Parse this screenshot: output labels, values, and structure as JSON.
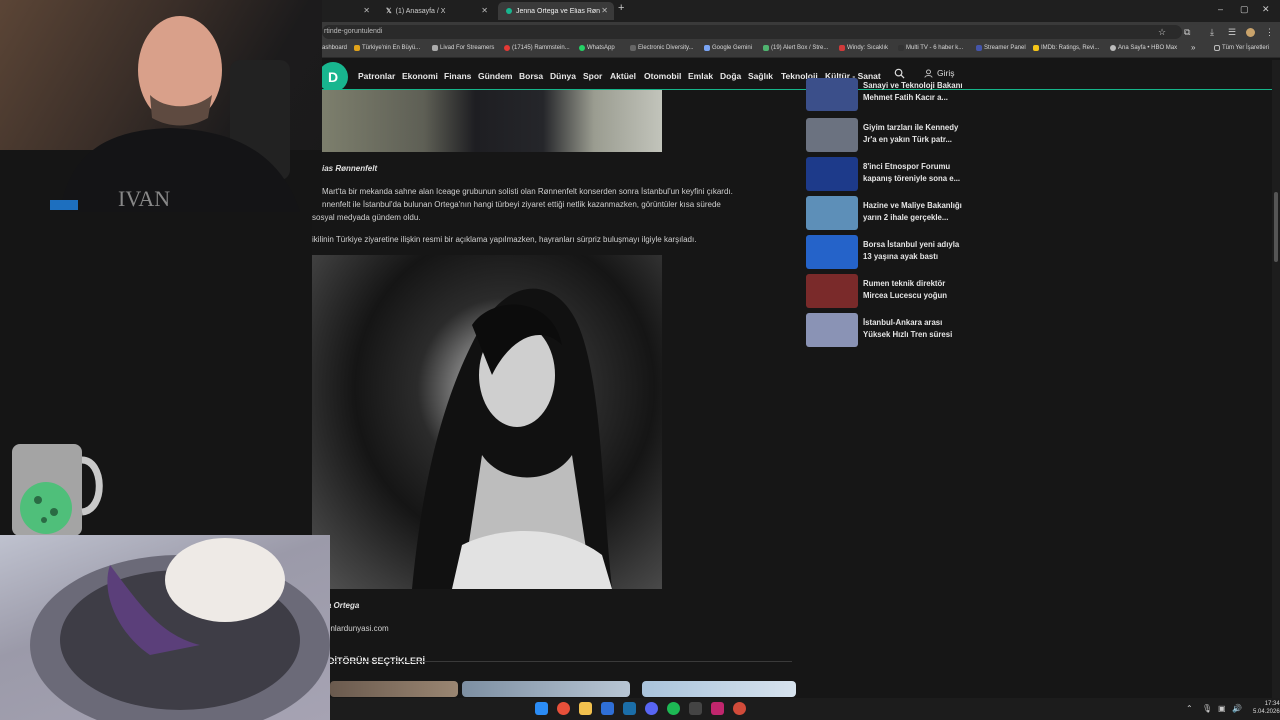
{
  "browser": {
    "tabs": [
      {
        "label": ""
      },
      {
        "label": "(1) Anasayfa / X"
      },
      {
        "label": "Jenna Ortega ve Elias Rønnenf..."
      }
    ],
    "url": "rtinde-goruntulendi",
    "bookmarks": [
      {
        "label": "ashboard"
      },
      {
        "label": "Türkiye'nin En Büyü..."
      },
      {
        "label": "Livad For Streamers"
      },
      {
        "label": "(17145) Rammstein..."
      },
      {
        "label": "WhatsApp"
      },
      {
        "label": "Electronic Diversity..."
      },
      {
        "label": "Google Gemini"
      },
      {
        "label": "(19) Alert Box / Stre..."
      },
      {
        "label": "Windy: Sıcaklık"
      },
      {
        "label": "Multi TV - 6 haber k..."
      },
      {
        "label": "Streamer Panel"
      },
      {
        "label": "IMDb: Ratings, Revi..."
      },
      {
        "label": "Ana Sayfa • HBO Max"
      }
    ],
    "more_bookmarks": "»",
    "all_bookmarks": "Tüm Yer İşaretleri"
  },
  "site": {
    "logo": "D",
    "nav": [
      "Patronlar",
      "Ekonomi",
      "Finans",
      "Gündem",
      "Borsa",
      "Dünya",
      "Spor",
      "Aktüel",
      "Otomobil",
      "Emlak",
      "Doğa",
      "Sağlık",
      "Teknoloji",
      "Kültür - Sanat"
    ],
    "login": "Giriş"
  },
  "article": {
    "caption1": "ias Rønnenfelt",
    "para1": "Mart'ta bir mekanda sahne alan Iceage grubunun solisti olan Rønnenfelt konserden sonra İstanbul'un keyfini çıkardı. nnenfelt ile İstanbul'da bulunan Ortega'nın hangi türbeyi ziyaret ettiği netlik kazanmazken, görüntüler kısa sürede sosyal medyada gündem oldu.",
    "para1_lines": [
      "Mart'ta bir mekanda sahne alan Iceage grubunun solisti olan Rønnenfelt konserden sonra İstanbul'un keyfini çıkardı.",
      "nnenfelt ile İstanbul'da bulunan Ortega'nın hangi türbeyi ziyaret ettiği netlik kazanmazken, görüntüler kısa sürede",
      "sosyal medyada gündem oldu."
    ],
    "para2": "ikilinin Türkiye ziyaretine ilişkin resmi bir açıklama yapılmazken, hayranları sürpriz buluşmayı ilgiyle karşıladı.",
    "caption2": "na Ortega",
    "source": "onlardunyasi.com",
    "editors_title": "DİTÖRÜN SEÇTİKLERİ"
  },
  "sidebar": {
    "news": [
      {
        "title": "Sanayi ve Teknoloji Bakanı Mehmet Fatih Kacır a...",
        "color": "#3b4f8a"
      },
      {
        "title": "Giyim tarzları ile Kennedy Jr'a en yakın Türk patr...",
        "color": "#6b7280"
      },
      {
        "title": "8'inci Etnospor Forumu kapanış töreniyle sona e...",
        "color": "#1d3a8a"
      },
      {
        "title": "Hazine ve Maliye Bakanlığı yarın 2 ihale gerçekle...",
        "color": "#5d8fb8"
      },
      {
        "title": "Borsa İstanbul yeni adıyla 13 yaşına ayak bastı",
        "color": "#2563c9"
      },
      {
        "title": "Rumen teknik direktör Mircea Lucescu yoğun ba...",
        "color": "#7a2a2a"
      },
      {
        "title": "İstanbul-Ankara arası Yüksek Hızlı Tren süresi kı...",
        "color": "#8a93b5"
      }
    ]
  },
  "taskbar": {
    "time": "17:34",
    "date": "5.04.2026"
  }
}
